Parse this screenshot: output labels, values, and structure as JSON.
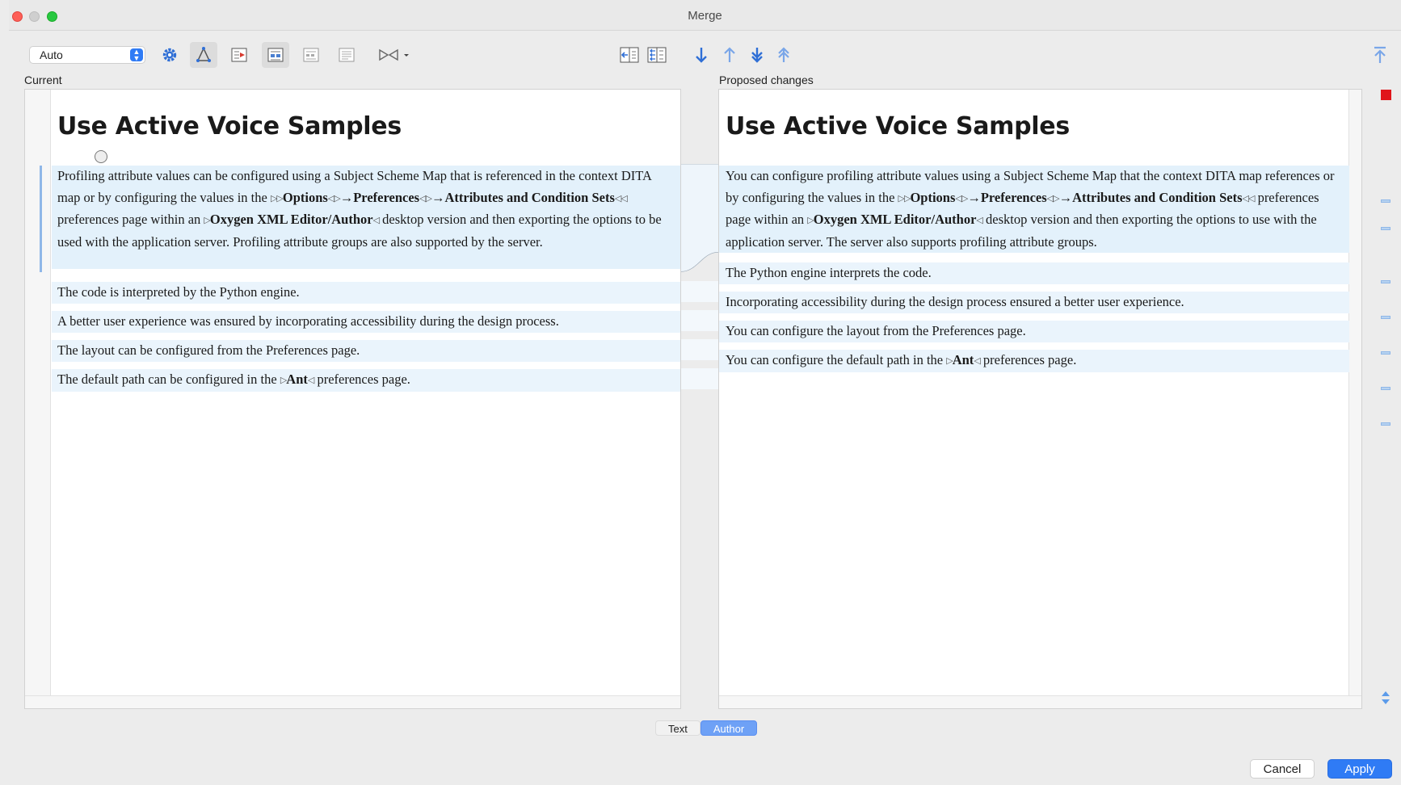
{
  "window": {
    "title": "Merge"
  },
  "toolbar": {
    "mode_select": {
      "value": "Auto"
    },
    "icons": [
      "settings-gear-icon",
      "merge-tree-icon",
      "show-changes-icon",
      "word-level-icon",
      "char-level-icon",
      "line-level-icon",
      "ignore-options-icon",
      "accept-left-icon",
      "accept-all-icon",
      "next-change-icon",
      "previous-change-icon",
      "next-block-icon",
      "previous-block-icon",
      "first-change-icon"
    ]
  },
  "left_pane": {
    "label": "Current",
    "title": "Use Active Voice Samples",
    "paragraphs": {
      "p1": {
        "a": "Profiling attribute values can be configured using a Subject Scheme Map that is referenced in the context DITA map or by configuring the values in the ",
        "tag1": "▷▷",
        "options": "Options",
        "tag2": "◁▷",
        "arrow1": "→",
        "preferences": "Preferences",
        "tag3": "◁▷",
        "arrow2": "→",
        "attributes": "Attributes and Condition Sets",
        "tag4": "◁◁",
        "b": " preferences page within an ",
        "tag5": "▷",
        "editor": "Oxygen XML Editor/Author",
        "tag6": "◁",
        "c": " desktop version and then exporting the options to be used with the application server. Profiling attribute groups are also supported by the server."
      },
      "p2": "The code is interpreted by the Python engine.",
      "p3": "A better user experience was ensured by incorporating accessibility during the design process.",
      "p4": "The layout can be configured from the Preferences page.",
      "p5": {
        "a": "The default path can be configured in the ",
        "tag1": "▷",
        "ant": "Ant",
        "tag2": "◁",
        "b": " preferences page."
      }
    }
  },
  "right_pane": {
    "label": "Proposed changes",
    "title": "Use Active Voice Samples",
    "paragraphs": {
      "p1": {
        "a": "You can configure profiling attribute values using a Subject Scheme Map that the context DITA map references or by configuring the values in the ",
        "tag1": "▷▷",
        "options": "Options",
        "tag2": "◁▷",
        "arrow1": "→",
        "preferences": "Preferences",
        "tag3": "◁▷",
        "arrow2": "→",
        "attributes": "Attributes and Condition Sets",
        "tag4": "◁◁",
        "b": " preferences page within an ",
        "tag5": "▷",
        "editor": "Oxygen XML Editor/Author",
        "tag6": "◁",
        "c": " desktop version and then exporting the options to use with the application server. The server also supports profiling attribute groups."
      },
      "p2": "The Python engine interprets the code.",
      "p3": "Incorporating accessibility during the design process ensured a better user experience.",
      "p4": "You can configure the layout from the Preferences page.",
      "p5": {
        "a": "You can configure the default path in the ",
        "tag1": "▷",
        "ant": "Ant",
        "tag2": "◁",
        "b": " preferences page."
      }
    }
  },
  "mode_tabs": {
    "text": "Text",
    "author": "Author",
    "active": "Author"
  },
  "buttons": {
    "cancel": "Cancel",
    "apply": "Apply"
  },
  "colors": {
    "accent": "#2f7bf5",
    "change_highlight": "#e3f1fb",
    "conflict_marker": "#e0151b"
  }
}
